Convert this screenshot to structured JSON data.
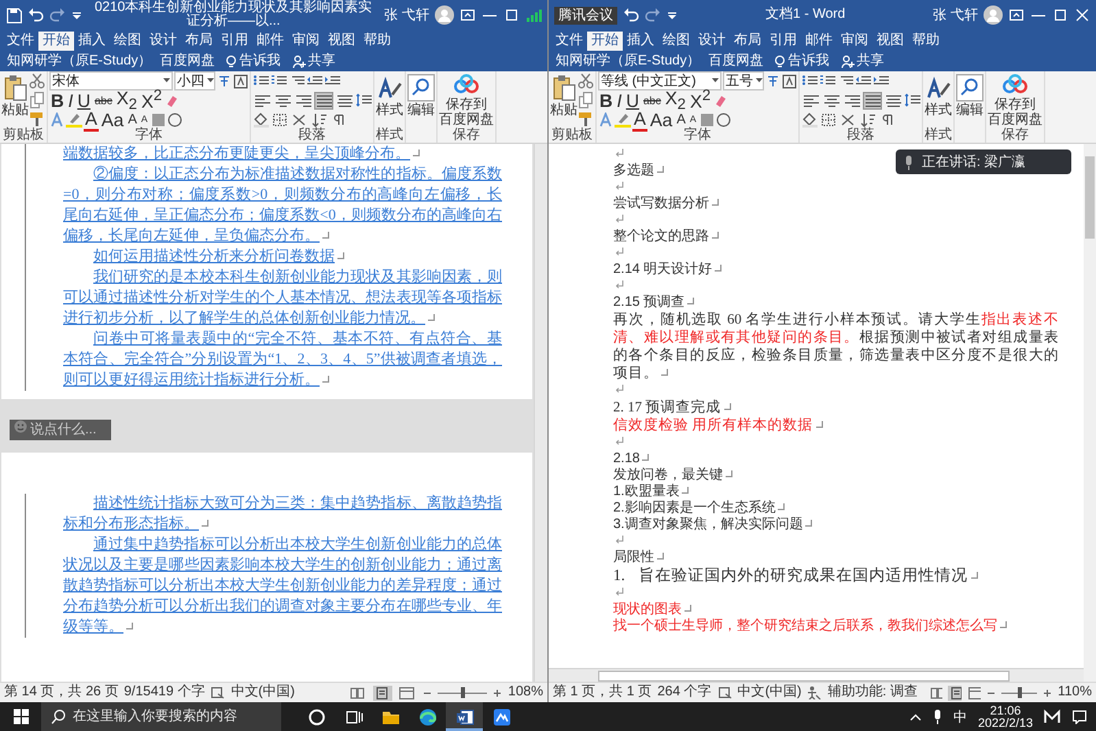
{
  "windows": [
    {
      "title_bar": {
        "title": "0210本科生创新创业能力现状及其影响因素实证分析——以...",
        "user": "张 弋轩",
        "window_buttons": [
          {
            "kind": "ribbon-options"
          },
          {
            "kind": "minimize"
          },
          {
            "kind": "maximize"
          },
          {
            "kind": "signal"
          }
        ]
      },
      "tabs": [
        {
          "label": "文件",
          "selected": false
        },
        {
          "label": "开始",
          "selected": true
        },
        {
          "label": "插入",
          "selected": false
        },
        {
          "label": "绘图",
          "selected": false
        },
        {
          "label": "设计",
          "selected": false
        },
        {
          "label": "布局",
          "selected": false
        },
        {
          "label": "引用",
          "selected": false
        },
        {
          "label": "邮件",
          "selected": false
        },
        {
          "label": "审阅",
          "selected": false
        },
        {
          "label": "视图",
          "selected": false
        },
        {
          "label": "帮助",
          "selected": false
        },
        {
          "label": "知网研学（原E-Study）",
          "selected": false
        },
        {
          "label": "百度网盘",
          "selected": false
        }
      ],
      "tell_me": "告诉我",
      "share": "共享",
      "ribbon": {
        "paste": "粘贴",
        "font": "宋体",
        "size": "小四",
        "format_buttons": [
          {
            "kind": "bold",
            "label": "B"
          },
          {
            "kind": "italic",
            "label": "I"
          },
          {
            "kind": "underline",
            "label": "U"
          },
          {
            "kind": "strike",
            "label": "abc"
          },
          {
            "kind": "sub",
            "label": "X$_{2}$"
          },
          {
            "kind": "sup",
            "label": "X$^{2}$"
          }
        ],
        "color_buttons": [
          {
            "kind": "font-color",
            "label": "A"
          },
          {
            "kind": "case",
            "label": "Aa"
          },
          {
            "kind": "grow",
            "label": "A"
          },
          {
            "kind": "shrink",
            "label": "A"
          }
        ],
        "alignment": [
          {
            "kind": "left",
            "selected": false
          },
          {
            "kind": "center",
            "selected": false
          },
          {
            "kind": "right",
            "selected": false
          },
          {
            "kind": "justify",
            "selected": true
          },
          {
            "kind": "distributed",
            "selected": false
          }
        ],
        "styles": "样式",
        "editing": "编辑",
        "save_to_cloud": [
          "保存到",
          "百度网盘"
        ],
        "groups": [
          "剪贴板",
          "字体",
          "段落",
          "样式",
          "保存"
        ]
      },
      "document": {
        "kind": "pages",
        "tracked_changes": true,
        "formatting_marks": true,
        "chat_box": {
          "placeholder": "说点什么..."
        },
        "pages": [
          {
            "paragraphs": [
              {
                "text": "端数据较多，比正态分布更陡更尖，呈尖顶峰分布。",
                "indent": false
              },
              {
                "text": "②偏度：以正态分布为标准描述数据对称性的指标。偏度系数=0，则分布对称；偏度系数>0，则频数分布的高峰向左偏移，长尾向右延伸，呈正偏态分布；偏度系数<0，则频数分布的高峰向右偏移，长尾向左延伸，呈负偏态分布。",
                "indent": true
              },
              {
                "text": "如何运用描述性分析来分析问卷数据",
                "indent": true
              },
              {
                "text": "我们研究的是本校本科生创新创业能力现状及其影响因素，则可以通过描述性分析对学生的个人基本情况、想法表现等各项指标进行初步分析，以了解学生的总体创新创业能力情况。",
                "indent": true
              },
              {
                "text": "问卷中可将量表题中的“完全不符、基本不符、有点符合、基本符合、完全符合”分别设置为“1、2、3、4、5”供被调查者填选，则可以更好得运用统计指标进行分析。",
                "indent": true
              }
            ]
          },
          {
            "paragraphs": [
              {
                "text": "描述性统计指标大致可分为三类：集中趋势指标、离散趋势指标和分布形态指标。",
                "indent": true
              },
              {
                "text": "通过集中趋势指标可以分析出本校大学生创新创业能力的总体状况以及主要是哪些因素影响本校大学生的创新创业能力；通过离散趋势指标可以分析出本校大学生创新创业能力的差异程度；通过分布趋势分析可以分析出我们的调查对象主要分布在哪些专业、年级等等。",
                "indent": true
              }
            ]
          }
        ]
      },
      "status_bar": {
        "page": "第 14 页，共 26 页",
        "words": "9/15419 个字",
        "language": "中文(中国)",
        "views": [
          {
            "kind": "read",
            "selected": false
          },
          {
            "kind": "print",
            "selected": true
          },
          {
            "kind": "web",
            "selected": false
          }
        ],
        "zoom_slider": {
          "level": 0.5
        },
        "zoom": "108%"
      }
    },
    {
      "title_bar": {
        "badge": "腾讯会议",
        "title": "文档1 - Word",
        "user": "张 弋轩",
        "window_buttons": [
          {
            "kind": "ribbon-options"
          },
          {
            "kind": "minimize"
          },
          {
            "kind": "maximize"
          },
          {
            "kind": "close"
          }
        ]
      },
      "tabs": [
        {
          "label": "文件",
          "selected": false
        },
        {
          "label": "开始",
          "selected": true
        },
        {
          "label": "插入",
          "selected": false
        },
        {
          "label": "绘图",
          "selected": false
        },
        {
          "label": "设计",
          "selected": false
        },
        {
          "label": "布局",
          "selected": false
        },
        {
          "label": "引用",
          "selected": false
        },
        {
          "label": "邮件",
          "selected": false
        },
        {
          "label": "审阅",
          "selected": false
        },
        {
          "label": "视图",
          "selected": false
        },
        {
          "label": "帮助",
          "selected": false
        },
        {
          "label": "知网研学（原E-Study）",
          "selected": false
        },
        {
          "label": "百度网盘",
          "selected": false
        }
      ],
      "tell_me": "告诉我",
      "share": "共享",
      "ribbon": {
        "paste": "粘贴",
        "font": "等线 (中文正文)",
        "size": "五号",
        "format_buttons": [
          {
            "kind": "bold",
            "label": "B"
          },
          {
            "kind": "italic",
            "label": "I"
          },
          {
            "kind": "underline",
            "label": "U"
          },
          {
            "kind": "strike",
            "label": "abc"
          },
          {
            "kind": "sub",
            "label": "X$_{2}$"
          },
          {
            "kind": "sup",
            "label": "X$^{2}$"
          }
        ],
        "color_buttons": [
          {
            "kind": "font-color",
            "label": "A"
          },
          {
            "kind": "case",
            "label": "Aa"
          },
          {
            "kind": "grow",
            "label": "A"
          },
          {
            "kind": "shrink",
            "label": "A"
          }
        ],
        "alignment": [
          {
            "kind": "left",
            "selected": false
          },
          {
            "kind": "center",
            "selected": false
          },
          {
            "kind": "right",
            "selected": false
          },
          {
            "kind": "justify",
            "selected": true
          },
          {
            "kind": "distributed",
            "selected": false
          }
        ],
        "styles": "样式",
        "editing": "编辑",
        "save_to_cloud": [
          "保存到",
          "百度网盘"
        ],
        "groups": [
          "剪贴板",
          "字体",
          "段落",
          "样式",
          "保存"
        ]
      },
      "document": {
        "kind": "lines",
        "formatting_marks": true,
        "speaker": "正在讲话: 梁广瀛",
        "lines": [
          {
            "kind": "blank"
          },
          {
            "kind": "sans",
            "text": "多选题",
            "red": false
          },
          {
            "kind": "blank"
          },
          {
            "kind": "sans",
            "text": "尝试写数据分析",
            "red": false
          },
          {
            "kind": "blank"
          },
          {
            "kind": "sans",
            "text": "整个论文的思路",
            "red": false
          },
          {
            "kind": "blank"
          },
          {
            "kind": "sans",
            "text": "2.14 明天设计好",
            "red": false
          },
          {
            "kind": "blank"
          },
          {
            "kind": "sans",
            "text": "2.15 预调查",
            "red": false
          },
          {
            "kind": "serif",
            "runs": [
              {
                "text": "再次，随机选取 60 名学生进行小样本预试。请大学生",
                "red": false
              },
              {
                "text": "指出表述不清、难以理解或有其他疑问的条目。",
                "red": true
              },
              {
                "text": "根据预测中被试者对组成量表的各个条目的反应，检验条目质量，筛选量表中区分度不是很大的项目。",
                "red": false
              }
            ]
          },
          {
            "kind": "blank"
          },
          {
            "kind": "serif",
            "text": "2. 17 预调查完成",
            "red": false
          },
          {
            "kind": "serif",
            "text": "信效度检验  用所有样本的数据",
            "red": true
          },
          {
            "kind": "blank"
          },
          {
            "kind": "sans",
            "text": "2.18",
            "red": false
          },
          {
            "kind": "sans",
            "text": "发放问卷，最关键",
            "red": false
          },
          {
            "kind": "sans",
            "text": "1.欧盟量表",
            "red": false
          },
          {
            "kind": "sans",
            "text": "2.影响因素是一个生态系统",
            "red": false
          },
          {
            "kind": "sans",
            "text": "3.调查对象聚焦，解决实际问题",
            "red": false
          },
          {
            "kind": "blank"
          },
          {
            "kind": "sans",
            "text": "局限性",
            "red": false
          },
          {
            "kind": "serif",
            "number": "1.",
            "text": "旨在验证国内外的研究成果在国内适用性情况",
            "red": false
          },
          {
            "kind": "blank"
          },
          {
            "kind": "sans",
            "text": "现状的图表",
            "red": true
          },
          {
            "kind": "sans",
            "text": "找一个硕士生导师，整个研究结束之后联系，教我们综述怎么写",
            "red": true
          }
        ]
      },
      "status_bar": {
        "page": "第 1 页，共 1 页",
        "words": "264 个字",
        "language": "中文(中国)",
        "accessibility": "辅助功能: 调查",
        "views": [
          {
            "kind": "read",
            "selected": false
          },
          {
            "kind": "print",
            "selected": true
          },
          {
            "kind": "web",
            "selected": false
          }
        ],
        "zoom_slider": {
          "level": 0.5
        },
        "zoom": "110%"
      }
    }
  ],
  "taskbar": {
    "search": {
      "placeholder": "在这里输入你要搜索的内容"
    },
    "apps": [
      {
        "kind": "cortana",
        "selected": false
      },
      {
        "kind": "task-view",
        "selected": false
      },
      {
        "kind": "explorer",
        "selected": false
      },
      {
        "kind": "edge",
        "selected": false
      },
      {
        "kind": "word",
        "selected": true
      },
      {
        "kind": "meeting",
        "selected": false
      }
    ],
    "tray": {
      "ime": "中",
      "time": "21:06",
      "date": "2022/2/13"
    }
  }
}
